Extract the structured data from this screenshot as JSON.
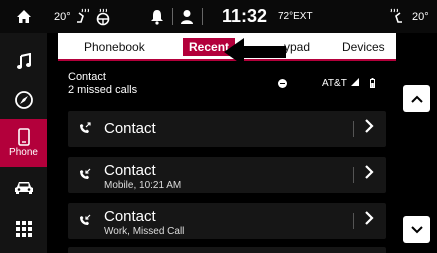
{
  "statusbar": {
    "left_temp": "20°",
    "time": "11:32",
    "ext_temp": "72°EXT",
    "right_temp": "20°"
  },
  "sidebar": {
    "items": [
      {
        "label": "",
        "icon": "music-note-icon"
      },
      {
        "label": "",
        "icon": "compass-icon"
      },
      {
        "label": "Phone",
        "icon": "phone-icon"
      },
      {
        "label": "",
        "icon": "car-icon"
      },
      {
        "label": "",
        "icon": "apps-grid-icon"
      }
    ],
    "accent": "#b3003b"
  },
  "tabs": [
    {
      "label": "Phonebook"
    },
    {
      "label": "Recent"
    },
    {
      "label": "ypad"
    },
    {
      "label": "Devices"
    }
  ],
  "status": {
    "title": "Contact",
    "subtitle": "2 missed calls",
    "carrier": "AT&T"
  },
  "calls": [
    {
      "name": "Contact",
      "detail": "",
      "type": "outgoing"
    },
    {
      "name": "Contact",
      "detail": "Mobile, 10:21 AM",
      "type": "incoming"
    },
    {
      "name": "Contact",
      "detail": "Work, Missed Call",
      "type": "incoming"
    }
  ]
}
